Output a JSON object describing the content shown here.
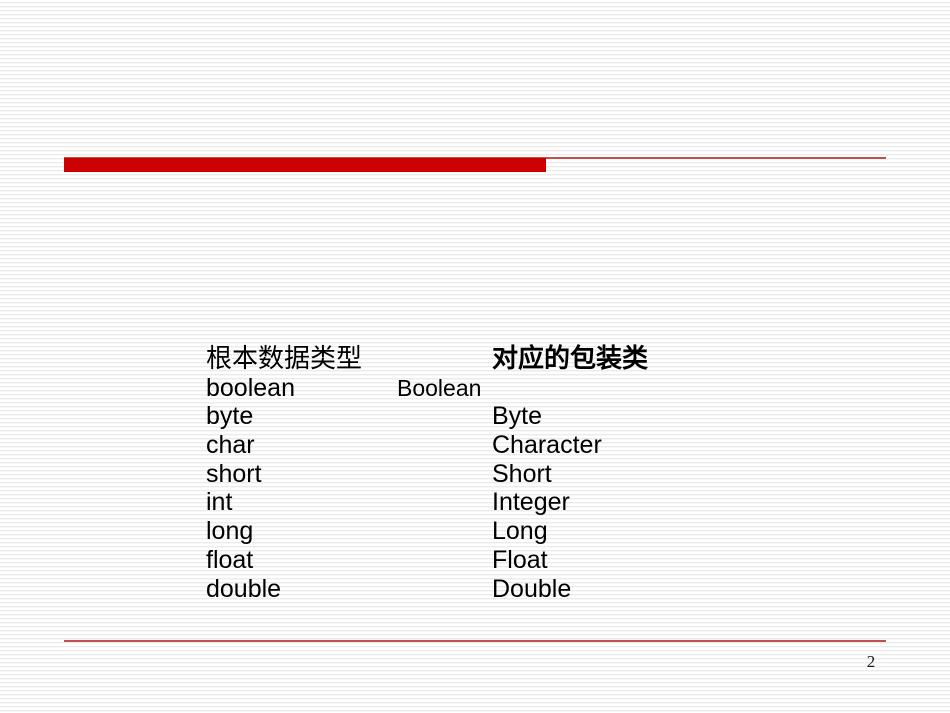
{
  "slide": {
    "title": "",
    "page_number": "2",
    "accent_color_bar": "#cc0000",
    "accent_color_rule": "#c0504d",
    "text_color": "#000000"
  },
  "table": {
    "header": {
      "left": "根本数据类型",
      "right": "对应的包装类"
    },
    "rows": [
      {
        "primitive": "boolean",
        "wrapper": "Boolean"
      },
      {
        "primitive": "byte",
        "wrapper": "Byte"
      },
      {
        "primitive": "char",
        "wrapper": "Character"
      },
      {
        "primitive": "short",
        "wrapper": "Short"
      },
      {
        "primitive": "int",
        "wrapper": "Integer"
      },
      {
        "primitive": "long",
        "wrapper": "Long"
      },
      {
        "primitive": "float",
        "wrapper": "Float"
      },
      {
        "primitive": "double",
        "wrapper": "Double"
      }
    ]
  }
}
